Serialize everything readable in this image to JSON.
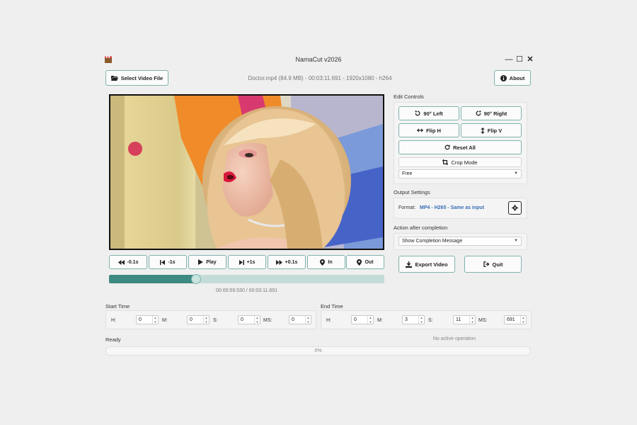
{
  "window": {
    "title": "NamaCut v2026",
    "controls": {
      "minimize": "—",
      "maximize": "☐",
      "close": "✕"
    }
  },
  "toolbar": {
    "select_file": "Select Video File",
    "about": "About"
  },
  "file_info": "Doctor.mp4 (84.9 MB) - 00:03:11.691 - 1920x1080 - h264",
  "playback": {
    "buttons": [
      "-0.1s",
      "-1s",
      "Play",
      "+1s",
      "+0.1s",
      "In",
      "Out"
    ],
    "position_fraction": 0.317,
    "timecode": "00:00:59.530 / 00:03:11.691"
  },
  "edit_controls": {
    "label": "Edit Controls",
    "rotate_left": "90° Left",
    "rotate_right": "90° Right",
    "flip_h": "Flip H",
    "flip_v": "Flip V",
    "reset": "Reset All",
    "crop_mode": "Crop Mode",
    "crop_ratio": "Free"
  },
  "output": {
    "label": "Output Settings",
    "format_label": "Format:",
    "format_value": "MP4 - H265 - Same as input"
  },
  "completion": {
    "label": "Action after completion",
    "value": "Show Completion Message"
  },
  "actions": {
    "export": "Export Video",
    "quit": "Quit"
  },
  "start_time": {
    "label": "Start Time",
    "h_label": "H:",
    "m_label": "M:",
    "s_label": "S:",
    "ms_label": "MS:",
    "h": "0",
    "m": "0",
    "s": "0",
    "ms": "0"
  },
  "end_time": {
    "label": "End Time",
    "h_label": "H:",
    "m_label": "M:",
    "s_label": "S:",
    "ms_label": "MS:",
    "h": "0",
    "m": "3",
    "s": "11",
    "ms": "691"
  },
  "status": {
    "left": "Ready",
    "right": "No active operation",
    "progress_text": "0%",
    "progress_fraction": 0
  },
  "colors": {
    "accent": "#3d8a82",
    "accent_light": "#c4dcd8",
    "link_blue": "#3a6fb5",
    "border": "#7fb3ad"
  }
}
